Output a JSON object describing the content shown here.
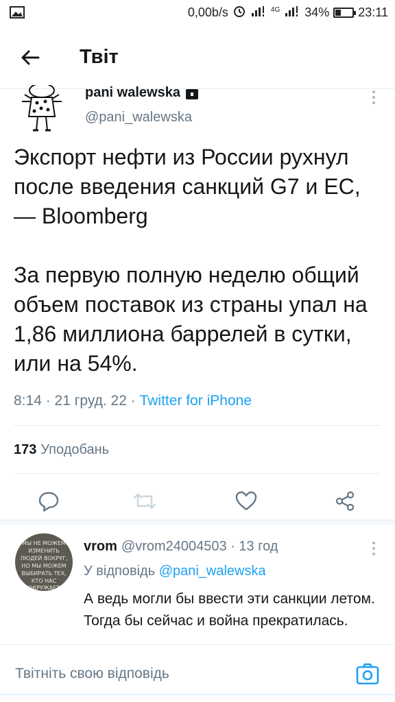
{
  "status_bar": {
    "net_speed": "0,00b/s",
    "network": "4G",
    "battery": "34%",
    "battery_level": 0.34,
    "time": "23:11"
  },
  "header": {
    "title": "Твіт"
  },
  "tweet": {
    "author_name": "pani walewska",
    "author_handle": "@pani_walewska",
    "text": "Экспорт нефти из России рухнул после введения санкций G7 и ЕС, — Bloomberg\n\nЗа первую полную неделю общий объем поставок из страны упал на 1,86 миллиона баррелей в сутки, или на 54%.",
    "time": "8:14 · 21 груд. 22 ·",
    "source": "Twitter for iPhone",
    "likes_count": "173",
    "likes_label": "Уподобань"
  },
  "reply": {
    "name": "vrom",
    "handle": "@vrom24004503 · 13 год",
    "reply_to_label": "У відповідь",
    "reply_to_handle": "@pani_walewska",
    "text": "А ведь могли бы ввести эти санкции летом. Тогда бы сейчас и война прекратилась.",
    "avatar_lines": [
      "МЫ НЕ МОЖЕМ",
      "ИЗМЕНИТЬ",
      "ЛЮДЕЙ ВОКРУГ,",
      "НО МЫ МОЖЕМ",
      "ВЫБИРАТЬ ТЕХ,",
      "КТО НАС ОКРУЖАЕТ"
    ]
  },
  "compose": {
    "placeholder": "Твітніть свою відповідь"
  },
  "colors": {
    "accent": "#1da1f2",
    "secondary_text": "#657786",
    "divider": "#e6ecf0"
  },
  "icons": {
    "back": "arrow-left-icon",
    "reply": "comment-icon",
    "retweet": "retweet-icon",
    "like": "heart-icon",
    "share": "share-icon",
    "camera": "camera-icon",
    "more": "more-vertical-icon"
  }
}
